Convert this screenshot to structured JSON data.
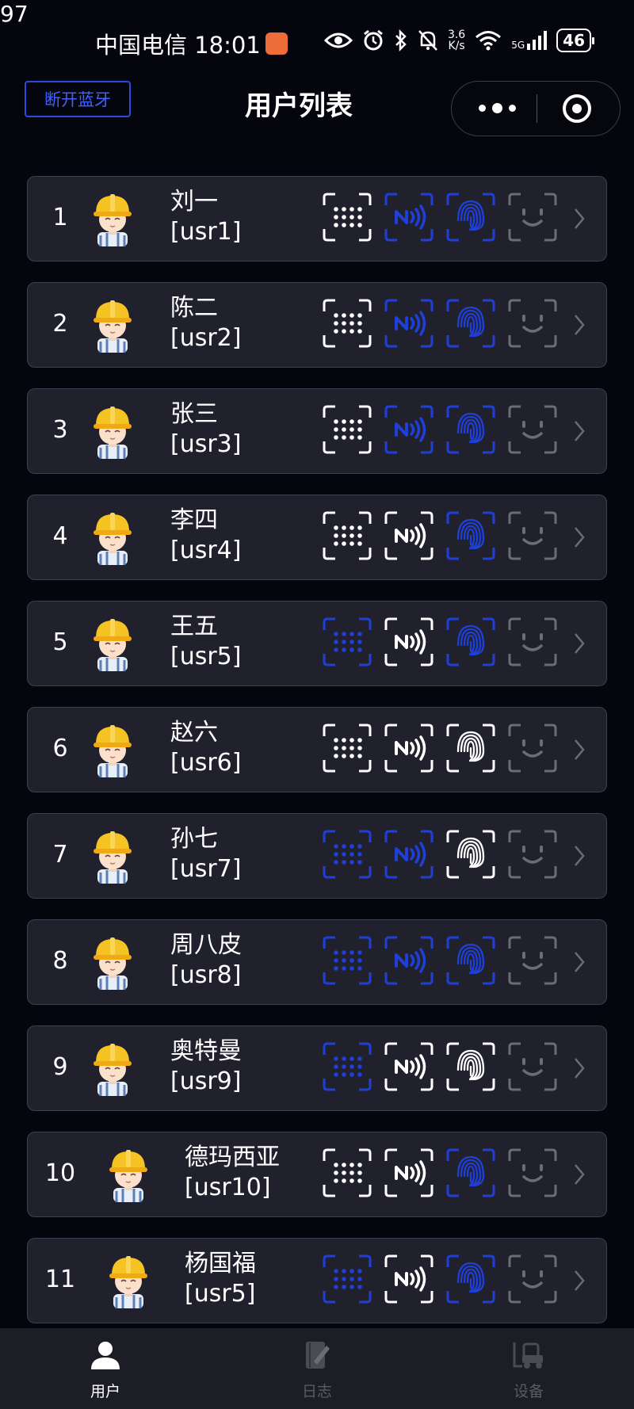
{
  "corner_text": "97",
  "status_bar": {
    "carrier_time": "中国电信 18:01",
    "net_speed_value": "3.6",
    "net_speed_unit": "K/s",
    "net_type": "5G",
    "battery": "46"
  },
  "nav": {
    "disconnect_button": "断开蓝牙",
    "title": "用户列表"
  },
  "users": [
    {
      "index": "1",
      "name": "刘一",
      "id": "[usr1]",
      "credentials": [
        "white",
        "blue",
        "blue",
        "gray"
      ]
    },
    {
      "index": "2",
      "name": "陈二",
      "id": "[usr2]",
      "credentials": [
        "white",
        "blue",
        "blue",
        "gray"
      ]
    },
    {
      "index": "3",
      "name": "张三",
      "id": "[usr3]",
      "credentials": [
        "white",
        "blue",
        "blue",
        "gray"
      ]
    },
    {
      "index": "4",
      "name": "李四",
      "id": "[usr4]",
      "credentials": [
        "white",
        "white",
        "blue",
        "gray"
      ]
    },
    {
      "index": "5",
      "name": "王五",
      "id": "[usr5]",
      "credentials": [
        "blue",
        "white",
        "blue",
        "gray"
      ]
    },
    {
      "index": "6",
      "name": "赵六",
      "id": "[usr6]",
      "credentials": [
        "white",
        "white",
        "white",
        "gray"
      ]
    },
    {
      "index": "7",
      "name": "孙七",
      "id": "[usr7]",
      "credentials": [
        "blue",
        "blue",
        "white",
        "gray"
      ]
    },
    {
      "index": "8",
      "name": "周八皮",
      "id": "[usr8]",
      "credentials": [
        "blue",
        "blue",
        "blue",
        "gray"
      ]
    },
    {
      "index": "9",
      "name": "奥特曼",
      "id": "[usr9]",
      "credentials": [
        "blue",
        "white",
        "white",
        "gray"
      ]
    },
    {
      "index": "10",
      "name": "德玛西亚",
      "id": "[usr10]",
      "credentials": [
        "white",
        "white",
        "blue",
        "gray"
      ]
    },
    {
      "index": "11",
      "name": "杨国福",
      "id": "[usr5]",
      "credentials": [
        "blue",
        "white",
        "blue",
        "gray"
      ]
    }
  ],
  "credential_icons": [
    "password-keypad-icon",
    "nfc-card-icon",
    "fingerprint-icon",
    "face-icon"
  ],
  "colors": {
    "white": "#ffffff",
    "blue": "#1f3fd6",
    "gray": "#6b6c75",
    "card_bg": "#20212d",
    "accent": "#2a4bdf"
  },
  "tabbar": {
    "tabs": [
      {
        "label": "用户",
        "active": true,
        "icon": "user-icon"
      },
      {
        "label": "日志",
        "active": false,
        "icon": "log-icon"
      },
      {
        "label": "设备",
        "active": false,
        "icon": "forklift-icon"
      }
    ]
  }
}
